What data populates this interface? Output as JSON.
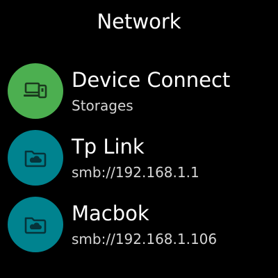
{
  "header": {
    "title": "Network"
  },
  "colors": {
    "device_circle": "#4caf50",
    "network_circle": "#00838f",
    "icon": "#1b3a1e",
    "icon_network": "#06343a"
  },
  "items": [
    {
      "label": "Device Connect",
      "subtitle": "Storages",
      "icon": "devices-icon"
    },
    {
      "label": "Tp Link",
      "subtitle": "smb://192.168.1.1",
      "icon": "cloud-folder-icon"
    },
    {
      "label": "Macbok",
      "subtitle": "smb://192.168.1.106",
      "icon": "cloud-folder-icon"
    }
  ]
}
